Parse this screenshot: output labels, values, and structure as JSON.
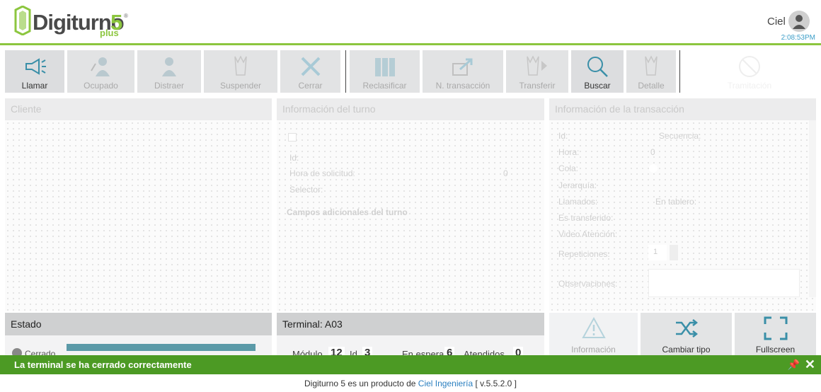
{
  "app": {
    "brand": "Digiturno",
    "version_mark": "5",
    "registered": "®",
    "edition": "plus"
  },
  "user": {
    "name": "Ciel",
    "clock": "2:08:53PM"
  },
  "toolbar": {
    "llamar": "Llamar",
    "ocupado": "Ocupado",
    "distraer": "Distraer",
    "suspender": "Suspender",
    "cerrar": "Cerrar",
    "reclasificar": "Reclasificar",
    "n_transaccion": "N. transacción",
    "transferir": "Transferir",
    "buscar": "Buscar",
    "detalle": "Detalle",
    "ghost": "Tramitación"
  },
  "cliente": {
    "title": "Cliente"
  },
  "turno": {
    "title": "Información del turno",
    "id_label": "Id:",
    "hora_label": "Hora de solicitud:",
    "hora_value": "0",
    "selector_label": "Selector:",
    "campos_label": "Campos adicionales del turno"
  },
  "transaccion": {
    "title": "Información de la transacción",
    "id_label": "Id:",
    "secuencia_label": "Secuencia:",
    "hora_label": "Hora:",
    "hora_value": "0",
    "cola_label": "Cola:",
    "jerarquia_label": "Jerarquía:",
    "llamados_label": "Llamados:",
    "tablero_label": "En tablero:",
    "transferido_label": "Es transferido:",
    "video_label": "Video Atención:",
    "repeticiones_label": "Repeticiones:",
    "repeticiones_value": "1",
    "observaciones_label": "Observaciones:"
  },
  "estado": {
    "title": "Estado",
    "status": "Cerrado"
  },
  "terminal": {
    "title": "Terminal: A03",
    "modulo_label": "Módulo",
    "modulo_value": "12",
    "id_label": "Id",
    "id_value": "3",
    "espera_label": "En espera",
    "espera_value": "6",
    "atendidos_label": "Atendidos",
    "atendidos_value": "0"
  },
  "actions": {
    "informacion": "Información",
    "cambiar_tipo": "Cambiar tipo",
    "fullscreen": "Fullscreen"
  },
  "notification": {
    "message": "La terminal se ha cerrado correctamente"
  },
  "footer": {
    "prefix": "Digiturno 5 es un producto de",
    "company": "Ciel Ingeniería",
    "version": "[ v.5.5.2.0 ]"
  },
  "colors": {
    "accent": "#8cc63f",
    "notify": "#4c9a24",
    "clock": "#3c9ec8",
    "icon_teal": "#3a8fa8",
    "bar": "#5b9aa8"
  },
  "icons": [
    "megaphone-icon",
    "busy-person-icon",
    "distract-person-icon",
    "suspend-ticket-icon",
    "close-x-icon",
    "folders-icon",
    "share-arrow-icon",
    "transfer-ticket-icon",
    "search-icon",
    "detail-ticket-icon",
    "disabled-icon",
    "warning-icon",
    "shuffle-icon",
    "fullscreen-icon",
    "pin-icon",
    "close-icon"
  ]
}
